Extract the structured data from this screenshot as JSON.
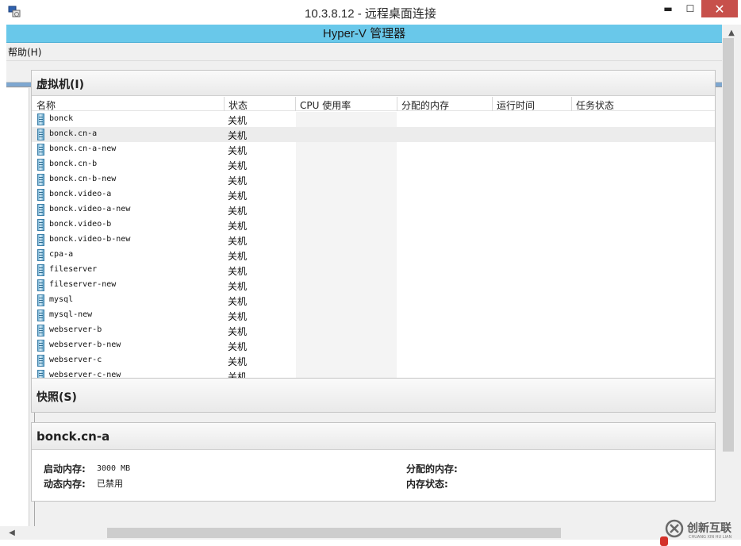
{
  "rdp_window": {
    "title": "10.3.8.12 - 远程桌面连接",
    "minimize_glyph": "▬",
    "maximize_glyph": "☐",
    "close_glyph": "✕"
  },
  "app": {
    "title": "Hyper-V 管理器",
    "menu": [
      "帮助(H)"
    ]
  },
  "vm_section": {
    "title": "虚拟机(I)",
    "columns": [
      "名称",
      "状态",
      "CPU 使用率",
      "分配的内存",
      "运行时间",
      "任务状态"
    ],
    "rows": [
      {
        "name": "bonck",
        "state": "关机"
      },
      {
        "name": "bonck.cn-a",
        "state": "关机",
        "selected": true
      },
      {
        "name": "bonck.cn-a-new",
        "state": "关机"
      },
      {
        "name": "bonck.cn-b",
        "state": "关机"
      },
      {
        "name": "bonck.cn-b-new",
        "state": "关机"
      },
      {
        "name": "bonck.video-a",
        "state": "关机"
      },
      {
        "name": "bonck.video-a-new",
        "state": "关机"
      },
      {
        "name": "bonck.video-b",
        "state": "关机"
      },
      {
        "name": "bonck.video-b-new",
        "state": "关机"
      },
      {
        "name": "cpa-a",
        "state": "关机"
      },
      {
        "name": "fileserver",
        "state": "关机"
      },
      {
        "name": "fileserver-new",
        "state": "关机"
      },
      {
        "name": "mysql",
        "state": "关机"
      },
      {
        "name": "mysql-new",
        "state": "关机"
      },
      {
        "name": "webserver-b",
        "state": "关机"
      },
      {
        "name": "webserver-b-new",
        "state": "关机"
      },
      {
        "name": "webserver-c",
        "state": "关机"
      },
      {
        "name": "webserver-c-new",
        "state": "关机"
      }
    ]
  },
  "snapshot_section": {
    "title": "快照(S)"
  },
  "detail_section": {
    "title": "bonck.cn-a",
    "startup_memory_label": "启动内存:",
    "startup_memory_value": "3000 MB",
    "dynamic_memory_label": "动态内存:",
    "dynamic_memory_value": "已禁用",
    "assigned_memory_label": "分配的内存:",
    "memory_status_label": "内存状态:"
  },
  "watermark": {
    "text": "创新互联",
    "sub": "CHUANG XIN HU LIAN"
  },
  "colors": {
    "app_title_bar": "#69c8ea",
    "rdp_close": "#c7504b",
    "watermark_red": "#d4312a"
  }
}
